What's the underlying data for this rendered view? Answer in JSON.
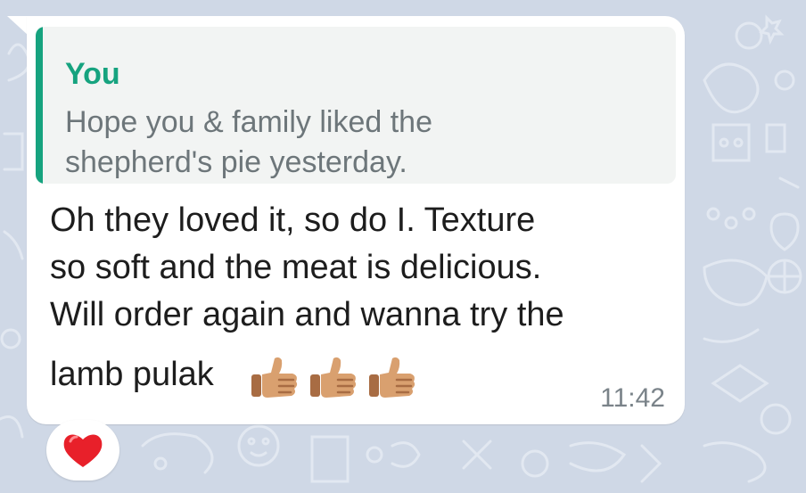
{
  "chat": {
    "background_color": "#cfd8e6",
    "bubble_color": "#ffffff"
  },
  "message": {
    "reply": {
      "author": "You",
      "author_color": "#16a37f",
      "text_lines": [
        "Hope you & family liked the",
        "shepherd's pie yesterday."
      ]
    },
    "text_lines": [
      "Oh they loved it, so do I. Texture",
      "so soft and the meat is delicious.",
      "Will order again and wanna try the",
      "lamb pulak"
    ],
    "emojis": [
      "thumbs-up-icon",
      "thumbs-up-icon",
      "thumbs-up-icon"
    ],
    "time": "11:42"
  },
  "reaction": {
    "emoji": "red-heart-icon"
  }
}
